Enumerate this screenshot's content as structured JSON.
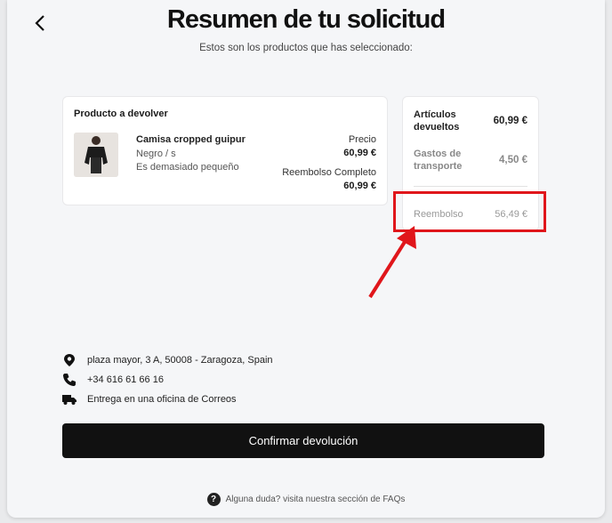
{
  "header": {
    "title": "Resumen de tu solicitud",
    "subtitle": "Estos son los productos que has seleccionado:"
  },
  "product_card": {
    "heading": "Producto a devolver",
    "name": "Camisa cropped guipur",
    "variant": "Negro / s",
    "reason": "Es demasiado pequeño",
    "price_label": "Precio",
    "price_value": "60,99 €",
    "refund_label": "Reembolso Completo",
    "refund_value": "60,99 €"
  },
  "summary": {
    "returned_label": "Artículos devueltos",
    "returned_value": "60,99 €",
    "shipping_label": "Gastos de transporte",
    "shipping_value": "4,50 €",
    "refund_label": "Reembolso",
    "refund_value": "56,49 €"
  },
  "delivery": {
    "address": "plaza mayor, 3 A, 50008 - Zaragoza, Spain",
    "phone": "+34 616 61 66 16",
    "method": "Entrega en una oficina de Correos"
  },
  "actions": {
    "confirm_label": "Confirmar devolución"
  },
  "footer": {
    "faq_text": "Alguna duda? visita nuestra sección de FAQs"
  },
  "colors": {
    "annotation": "#e0161b",
    "button_bg": "#111111"
  },
  "icons": [
    "chevron-left-icon",
    "location-pin-icon",
    "phone-icon",
    "truck-icon",
    "question-icon",
    "annotation-arrow"
  ]
}
